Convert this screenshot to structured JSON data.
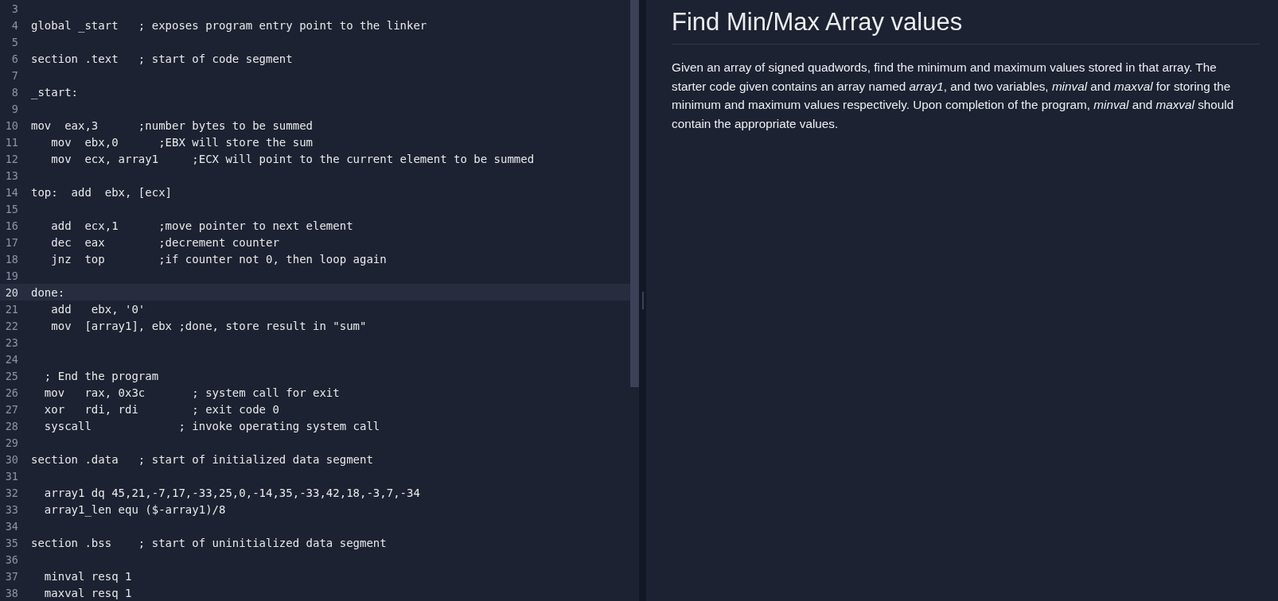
{
  "editor": {
    "lines": [
      {
        "number": "3",
        "active": false
      },
      {
        "number": "4",
        "text": "global _start   ; exposes program entry point to the linker",
        "active": false
      },
      {
        "number": "5",
        "active": false
      },
      {
        "number": "6",
        "text": "section .text   ; start of code segment",
        "active": false
      },
      {
        "number": "7",
        "active": false
      },
      {
        "number": "8",
        "text": "_start:",
        "active": false
      },
      {
        "number": "9",
        "active": false
      },
      {
        "number": "10",
        "text": "mov  eax,3      ;number bytes to be summed",
        "active": false
      },
      {
        "number": "11",
        "text": "   mov  ebx,0      ;EBX will store the sum",
        "active": false
      },
      {
        "number": "12",
        "text": "   mov  ecx, array1     ;ECX will point to the current element to be summed",
        "active": false
      },
      {
        "number": "13",
        "active": false
      },
      {
        "number": "14",
        "text": "top:  add  ebx, [ecx]",
        "active": false
      },
      {
        "number": "15",
        "active": false
      },
      {
        "number": "16",
        "text": "   add  ecx,1      ;move pointer to next element",
        "active": false
      },
      {
        "number": "17",
        "text": "   dec  eax        ;decrement counter",
        "active": false
      },
      {
        "number": "18",
        "text": "   jnz  top        ;if counter not 0, then loop again",
        "active": false
      },
      {
        "number": "19",
        "active": false
      },
      {
        "number": "20",
        "text": "done:",
        "active": true
      },
      {
        "number": "21",
        "text": "   add   ebx, '0'",
        "active": false
      },
      {
        "number": "22",
        "text": "   mov  [array1], ebx ;done, store result in \"sum\"",
        "active": false
      },
      {
        "number": "23",
        "active": false
      },
      {
        "number": "24",
        "active": false
      },
      {
        "number": "25",
        "text": "  ; End the program",
        "active": false
      },
      {
        "number": "26",
        "text": "  mov   rax, 0x3c       ; system call for exit",
        "active": false
      },
      {
        "number": "27",
        "text": "  xor   rdi, rdi        ; exit code 0",
        "active": false
      },
      {
        "number": "28",
        "text": "  syscall             ; invoke operating system call",
        "active": false
      },
      {
        "number": "29",
        "active": false
      },
      {
        "number": "30",
        "text": "section .data   ; start of initialized data segment",
        "active": false
      },
      {
        "number": "31",
        "active": false
      },
      {
        "number": "32",
        "text": "  array1 dq 45,21,-7,17,-33,25,0,-14,35,-33,42,18,-3,7,-34",
        "active": false
      },
      {
        "number": "33",
        "text": "  array1_len equ ($-array1)/8",
        "active": false
      },
      {
        "number": "34",
        "active": false
      },
      {
        "number": "35",
        "text": "section .bss    ; start of uninitialized data segment",
        "active": false
      },
      {
        "number": "36",
        "active": false
      },
      {
        "number": "37",
        "text": "  minval resq 1",
        "active": false
      },
      {
        "number": "38",
        "text": "  maxval resq 1",
        "active": false
      }
    ]
  },
  "problem": {
    "title": "Find Min/Max Array values",
    "description": "Given an array of signed quadwords, find the minimum and maximum values stored in that array. The starter code given contains an array named *array1*, and two variables, *minval* and *maxval* for storing the minimum and maximum values respectively. Upon completion of the program, *minval* and *maxval* should contain the appropriate values."
  }
}
